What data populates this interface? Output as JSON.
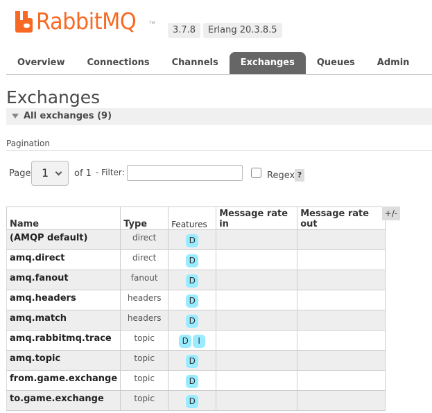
{
  "header": {
    "logo_text": "RabbitMQ",
    "logo_tm": "TM",
    "rabbitmq_version": "3.7.8",
    "erlang_version": "Erlang 20.3.8.5",
    "brand_color": "#f86a23"
  },
  "nav": {
    "tabs": [
      {
        "label": "Overview",
        "active": false
      },
      {
        "label": "Connections",
        "active": false
      },
      {
        "label": "Channels",
        "active": false
      },
      {
        "label": "Exchanges",
        "active": true
      },
      {
        "label": "Queues",
        "active": false
      },
      {
        "label": "Admin",
        "active": false
      }
    ]
  },
  "page": {
    "title": "Exchanges",
    "section_label": "All exchanges (9)"
  },
  "pagination": {
    "section_label": "Pagination",
    "page_label": "Page",
    "selected_page": "1",
    "of_label": "of 1",
    "filter_label": "- Filter:",
    "filter_value": "",
    "regex_label": "Regex",
    "regex_checked": false,
    "help_label": "?"
  },
  "table": {
    "columns": [
      "Name",
      "Type",
      "Features",
      "Message rate in",
      "Message rate out"
    ],
    "toggle_label": "+/-",
    "rows": [
      {
        "name": "(AMQP default)",
        "type": "direct",
        "features": [
          "D"
        ],
        "rate_in": "",
        "rate_out": ""
      },
      {
        "name": "amq.direct",
        "type": "direct",
        "features": [
          "D"
        ],
        "rate_in": "",
        "rate_out": ""
      },
      {
        "name": "amq.fanout",
        "type": "fanout",
        "features": [
          "D"
        ],
        "rate_in": "",
        "rate_out": ""
      },
      {
        "name": "amq.headers",
        "type": "headers",
        "features": [
          "D"
        ],
        "rate_in": "",
        "rate_out": ""
      },
      {
        "name": "amq.match",
        "type": "headers",
        "features": [
          "D"
        ],
        "rate_in": "",
        "rate_out": ""
      },
      {
        "name": "amq.rabbitmq.trace",
        "type": "topic",
        "features": [
          "D",
          "I"
        ],
        "rate_in": "",
        "rate_out": ""
      },
      {
        "name": "amq.topic",
        "type": "topic",
        "features": [
          "D"
        ],
        "rate_in": "",
        "rate_out": ""
      },
      {
        "name": "from.game.exchange",
        "type": "topic",
        "features": [
          "D"
        ],
        "rate_in": "",
        "rate_out": ""
      },
      {
        "name": "to.game.exchange",
        "type": "topic",
        "features": [
          "D"
        ],
        "rate_in": "",
        "rate_out": ""
      }
    ]
  }
}
